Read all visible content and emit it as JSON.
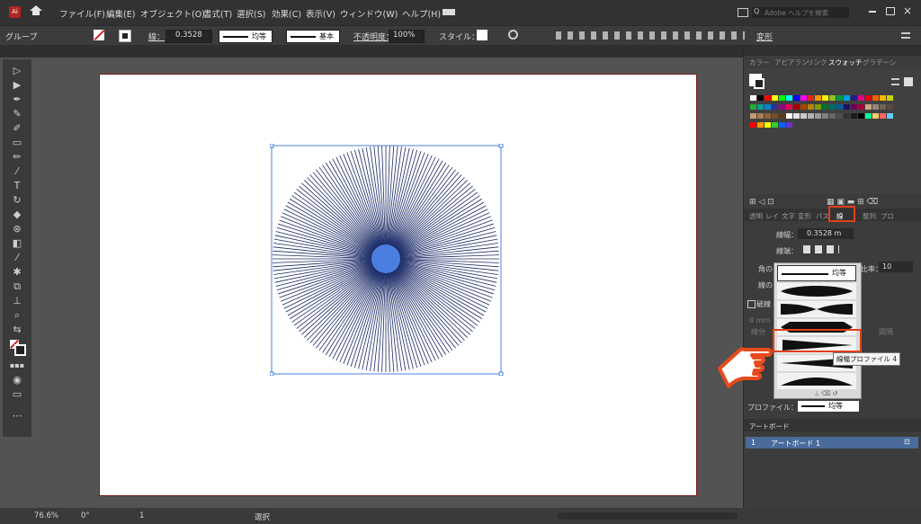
{
  "menubar": {
    "items": [
      "ファイル(F)",
      "編集(E)",
      "オブジェクト(O)",
      "書式(T)",
      "選択(S)",
      "効果(C)",
      "表示(V)",
      "ウィンドウ(W)",
      "ヘルプ(H)"
    ],
    "search_placeholder": "Adobe ヘルプを検索"
  },
  "controlbar": {
    "selection_label": "グループ",
    "stroke_label": "線：",
    "stroke_value": "0.3528",
    "profile_label": "均等",
    "brush_label": "基本",
    "opacity_label": "不透明度：",
    "opacity_value": "100%",
    "style_label": "スタイル：",
    "transform_label": "変形"
  },
  "statusbar": {
    "zoom": "76.6%",
    "rotation": "0°",
    "artboard_num": "1",
    "mode": "選択"
  },
  "panel": {
    "top_tabs": [
      "カラー",
      "アピアラン",
      "リンク",
      "スウォッチ",
      "グラデーシ"
    ],
    "stroke_tabs": [
      "透明",
      "レイ",
      "文字",
      "変形",
      "パス",
      "線",
      "整列",
      "プロ"
    ],
    "width_label": "線幅：",
    "width_value": "0.3528 m",
    "cap_label": "線端：",
    "corner_label": "角の",
    "limit_label": "比率：",
    "limit_value": "10",
    "align_label": "線の",
    "dashed_label": "破線",
    "profile_label": "プロファイル：",
    "profile_value": "均等",
    "dash_label": "線分",
    "gap_label": "間隔",
    "mm_value": "0 mm",
    "artboard_tab": "アートボード",
    "artboard_num": "1",
    "artboard_name": "アートボード 1"
  },
  "popup": {
    "selected_label": "均等",
    "tooltip": "線幅プロファイル 4"
  },
  "colors": {
    "accent_highlight": "#e0401a",
    "hand_pointer": "#e84a1c",
    "selection_blue": "#4a7fe0",
    "artboard_border": "#7a1a1a"
  },
  "icons": [
    "home-icon",
    "ai-logo-icon",
    "selection-tool-icon",
    "direct-selection-icon",
    "pen-icon",
    "type-icon",
    "hand-pointer-icon"
  ]
}
